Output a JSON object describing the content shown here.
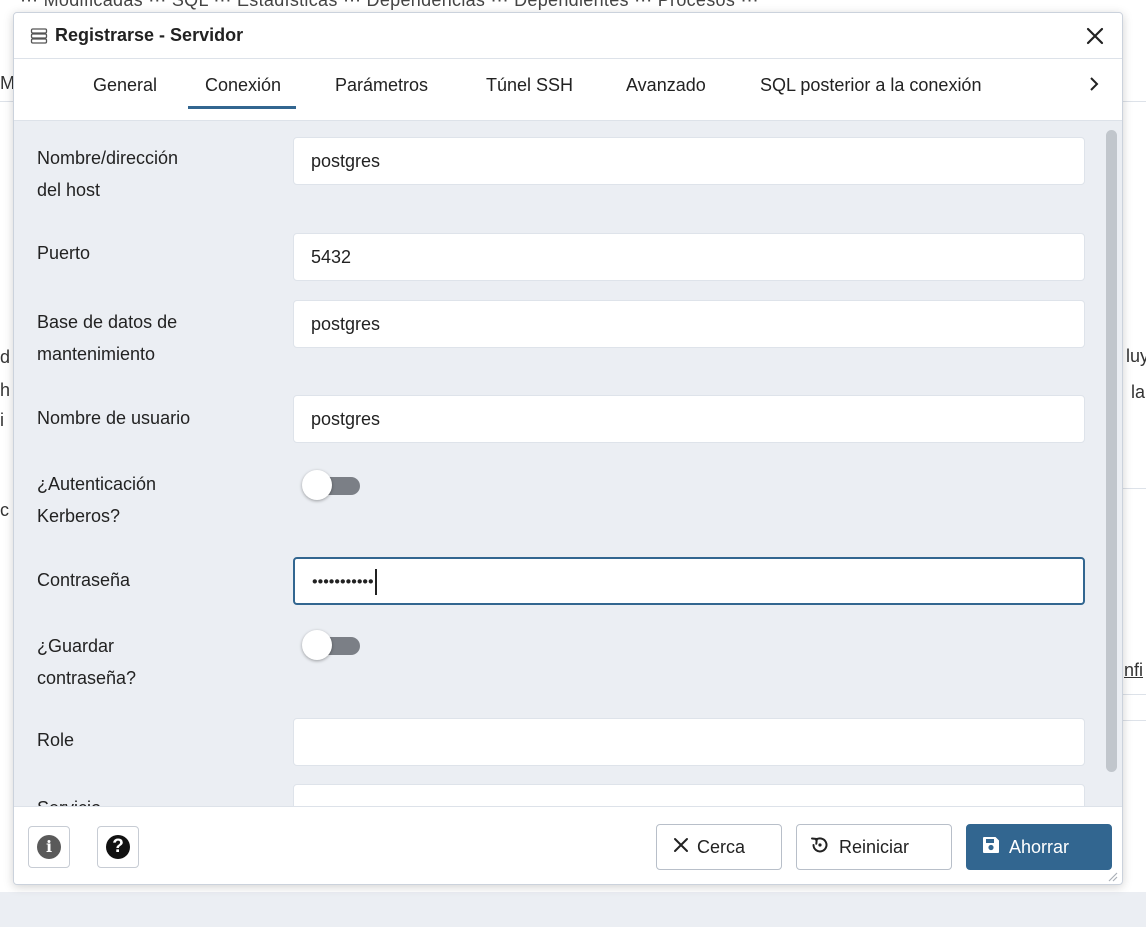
{
  "background": {
    "top_strip_text": "⋯  Modificadas ⋯  SQL ⋯  Estadísticas ⋯  Dependencias ⋯  Dependientes ⋯  Procesos ⋯",
    "left_fragments": [
      "M",
      "d",
      "h",
      "i",
      "c"
    ],
    "right_fragments": [
      "luy",
      "la",
      "nfi"
    ]
  },
  "dialog": {
    "title": "Registrarse - Servidor",
    "icon": "server-icon",
    "close_icon": "close-icon",
    "tabs": [
      {
        "label": "General",
        "active": false
      },
      {
        "label": "Conexión",
        "active": true
      },
      {
        "label": "Parámetros",
        "active": false
      },
      {
        "label": "Túnel SSH",
        "active": false
      },
      {
        "label": "Avanzado",
        "active": false
      },
      {
        "label": "SQL posterior a la conexión",
        "active": false
      }
    ],
    "tabs_next_icon": "chevron-right-icon",
    "fields": {
      "host": {
        "label_line1": "Nombre/dirección",
        "label_line2": "del host",
        "value": "postgres"
      },
      "port": {
        "label": "Puerto",
        "value": "5432"
      },
      "maintenance_db": {
        "label_line1": "Base de datos de",
        "label_line2": "mantenimiento",
        "value": "postgres"
      },
      "username": {
        "label": "Nombre de usuario",
        "value": "postgres"
      },
      "kerberos": {
        "label_line1": "¿Autenticación",
        "label_line2": "Kerberos?",
        "enabled": false
      },
      "password": {
        "label": "Contraseña",
        "masked_value": "•••••••••••",
        "focused": true
      },
      "save_password": {
        "label_line1": "¿Guardar",
        "label_line2": "contraseña?",
        "enabled": false
      },
      "role": {
        "label": "Role",
        "value": ""
      },
      "service": {
        "label": "Servicio",
        "value": ""
      }
    },
    "footer": {
      "info_icon": "info-icon",
      "help_icon": "help-icon",
      "close_label": "Cerca",
      "reset_label": "Reiniciar",
      "save_label": "Ahorrar"
    },
    "colors": {
      "accent": "#326690",
      "dialog_bg": "#ebeef3",
      "toggle_off": "#7b7f86"
    }
  }
}
